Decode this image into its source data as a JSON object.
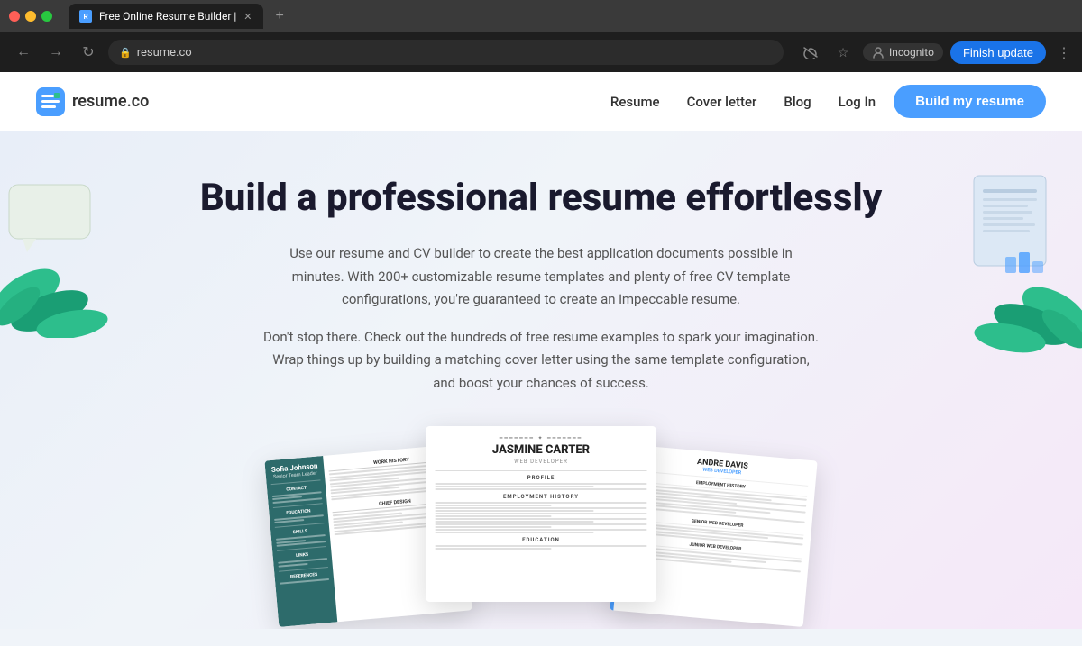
{
  "browser": {
    "tab": {
      "title": "Free Online Resume Builder |",
      "favicon_label": "R"
    },
    "url": "resume.co",
    "incognito_label": "Incognito",
    "finish_update_label": "Finish update",
    "new_tab_symbol": "+"
  },
  "nav": {
    "logo_text": "resume.co",
    "links": [
      {
        "label": "Resume"
      },
      {
        "label": "Cover letter"
      },
      {
        "label": "Blog"
      }
    ],
    "login_label": "Log In",
    "cta_label": "Build my resume"
  },
  "hero": {
    "title": "Build a professional resume effortlessly",
    "desc1": "Use our resume and CV builder to create the best application documents possible in minutes. With 200+ customizable resume templates and plenty of free CV template configurations, you're guaranteed to create an impeccable resume.",
    "desc2": "Don't stop there. Check out the hundreds of free resume examples to spark your imagination. Wrap things up by building a matching cover letter using the same template configuration, and boost your chances of success."
  },
  "resumes": {
    "left": {
      "name": "Sofia Johnson",
      "role": "Senior Team Leader"
    },
    "center": {
      "name": "JASMINE CARTER",
      "role": "WEB DEVELOPER"
    },
    "right": {
      "name": "ANDRE DAVIS",
      "role": "WEB DEVELOPER"
    }
  }
}
